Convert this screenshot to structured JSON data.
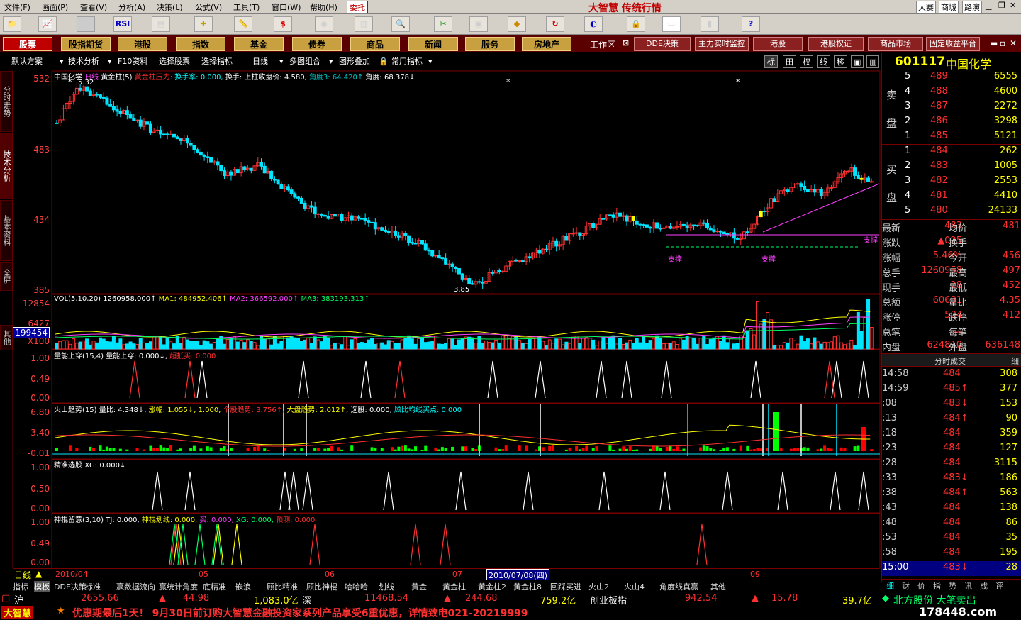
{
  "menu": {
    "items": [
      "文件(F)",
      "画面(P)",
      "查看(V)",
      "分析(A)",
      "决策(L)",
      "公式(V)",
      "工具(T)",
      "窗口(W)",
      "帮助(H)"
    ],
    "entrust": "委托",
    "app_title": "大智慧 传统行情",
    "right_items": [
      "大赛",
      "商城",
      "路演"
    ]
  },
  "toolbar": {
    "rsi": "RSI"
  },
  "categories": {
    "items": [
      "股票",
      "股指期货",
      "港股",
      "指数",
      "基金",
      "债券",
      "商品",
      "新闻",
      "服务",
      "房地产"
    ],
    "workspace": "工作区",
    "items2": [
      "DDE决策",
      "主力实时监控",
      "港股",
      "港股权证",
      "商品市场",
      "固定收益平台"
    ]
  },
  "subbar": {
    "items": [
      "默认方案",
      "技术分析",
      "F10资料",
      "选择股票",
      "选择指标",
      "日线",
      "多图组合",
      "图形叠加",
      "常用指标"
    ],
    "right_buttons": [
      "标",
      "田",
      "权",
      "线",
      "移"
    ]
  },
  "vtabs": [
    "分时走势",
    "技术分析",
    "基本资料",
    "全屏",
    "其他"
  ],
  "main_chart": {
    "title": "中国化学",
    "period": "日线",
    "indicator": "黄金柱(5)",
    "ind_a": "黄金柱压力:",
    "ind_b": "换手率: 0.000,",
    "ind_c": "换手: 上柱收盘价: 4.580,",
    "ind_d": "角度3: 64.420↑",
    "ind_e": "角度: 68.378↓",
    "high_label": "5.32",
    "low_label": "3.85",
    "support_label": "支撑",
    "axis": [
      "532",
      "483",
      "434",
      "385"
    ]
  },
  "vol": {
    "label": "VOL(5,10,20)",
    "value": "1260958.000↑",
    "ma1": "MA1: 484952.406↑",
    "ma2": "MA2: 366592.000↑",
    "ma3": "MA3: 383193.313↑",
    "axis": [
      "12854",
      "6427"
    ],
    "unit": "X100",
    "cursor_value": "199454"
  },
  "p3": {
    "label": "量能上穿(15,4)",
    "v1": "量能上穿: 0.000↓,",
    "v2": "超抵买: 0.000",
    "axis": [
      "1.00",
      "0.49",
      "0.00"
    ]
  },
  "p4": {
    "label": "火山趋势(15)",
    "v1": "量比: 4.348↓,",
    "v2": "涨幅: 1.055↓,",
    "v3": "1.000,",
    "v4": "个股趋势: 3.756↑,",
    "v5": "大盘趋势: 2.012↑,",
    "v6": "选股: 0.000,",
    "v7": "顾比均线买点: 0.000",
    "axis": [
      "6.80",
      "3.40",
      "-0.01"
    ]
  },
  "p5": {
    "label": "精准选股",
    "v1": "XG: 0.000↓",
    "axis": [
      "1.00",
      "0.50",
      "0.00"
    ]
  },
  "p6": {
    "label": "神棍留意(3,10)",
    "v1": "TJ: 0.000,",
    "v2": "神棍划线: 0.000,",
    "v3": "买: 0.000,",
    "v4": "XG: 0.000,",
    "v5": "预测: 0.000",
    "axis": [
      "1.00",
      "0.49",
      "0.00"
    ]
  },
  "time_axis": {
    "period": "日线",
    "labels": [
      "2010/04",
      "05",
      "06",
      "07",
      "09"
    ],
    "cursor_date": "2010/07/08(四)"
  },
  "right_panel": {
    "code": "601117",
    "name": "中国化学",
    "sell_label": [
      "卖",
      "盘"
    ],
    "buy_label": [
      "买",
      "盘"
    ],
    "sell": [
      [
        "5",
        "489",
        "6555"
      ],
      [
        "4",
        "488",
        "4600"
      ],
      [
        "3",
        "487",
        "2272"
      ],
      [
        "2",
        "486",
        "3298"
      ],
      [
        "1",
        "485",
        "5121"
      ]
    ],
    "buy": [
      [
        "1",
        "484",
        "262"
      ],
      [
        "2",
        "483",
        "1005"
      ],
      [
        "3",
        "482",
        "2553"
      ],
      [
        "4",
        "481",
        "4410"
      ],
      [
        "5",
        "480",
        "24133"
      ]
    ],
    "stats": [
      [
        "最新",
        "483",
        "均价",
        "481"
      ],
      [
        "涨跌",
        "▲025",
        "换手",
        ""
      ],
      [
        "涨幅",
        "5.46%",
        "今开",
        "456"
      ],
      [
        "总手",
        "1260958",
        "最高",
        "497"
      ],
      [
        "现手",
        "28",
        "最低",
        "452"
      ],
      [
        "总额",
        "60681",
        "量比",
        "4.35"
      ],
      [
        "涨停",
        "504",
        "跌停",
        "412"
      ],
      [
        "总笔",
        "－",
        "每笔",
        ""
      ],
      [
        "内盘",
        "624810",
        "外盘",
        "636148"
      ]
    ],
    "ticks_title": "分时成交",
    "ticks_btn": "细",
    "ticks": [
      [
        "14:58",
        "484",
        "308",
        ""
      ],
      [
        "14:59",
        "485↑",
        "377",
        ""
      ],
      [
        ":08",
        "483↓",
        "153",
        ""
      ],
      [
        ":13",
        "484↑",
        "90",
        ""
      ],
      [
        ":18",
        "484",
        "359",
        ""
      ],
      [
        ":23",
        "484",
        "127",
        ""
      ],
      [
        ":28",
        "484",
        "3115",
        ""
      ],
      [
        ":33",
        "483↓",
        "186",
        ""
      ],
      [
        ":38",
        "484↑",
        "563",
        ""
      ],
      [
        ":43",
        "484",
        "138",
        ""
      ],
      [
        ":48",
        "484",
        "86",
        ""
      ],
      [
        ":53",
        "484",
        "35",
        ""
      ],
      [
        ":58",
        "484",
        "195",
        ""
      ],
      [
        "15:00",
        "483↓",
        "28",
        ""
      ]
    ],
    "bottom_tabs": [
      "细",
      "财",
      "价",
      "指",
      "势",
      "讯",
      "成",
      "评"
    ]
  },
  "bottom_tabs": [
    "指标",
    "模板",
    "DDE决策",
    "标准",
    "赢数据流向",
    "赢统计角度",
    "底精准",
    "嵌浪",
    "顾比精准",
    "顾比神棍",
    "哈哈哈",
    "划线",
    "黄金",
    "黄金柱",
    "黄金柱2",
    "黄金柱8",
    "回踩买进",
    "火山2",
    "火山4",
    "角度线真赢",
    "其他"
  ],
  "status": {
    "sh": "沪",
    "sh_index": "2655.66",
    "sh_chg": "44.98",
    "sh_amt": "1,083.0亿",
    "sz": "深",
    "sz_index": "11468.54",
    "sz_chg": "244.68",
    "sz_amt": "759.2亿",
    "cyb": "创业板指",
    "cyb_index": "942.54",
    "cyb_chg": "15.78",
    "cyb_amt": "39.7亿",
    "news": "北方股份 大笔卖出"
  },
  "ticker": {
    "brand": "大智慧",
    "text": "优惠期最后1天！ 9月30日前订购大智慧金融投资家系列产品享受6重优惠，详情致电021-20219999",
    "watermark": "178448.com"
  },
  "colors": {
    "up": "#ff3030",
    "down": "#00e5ff",
    "bg": "#000000",
    "frame": "#7a0000"
  }
}
